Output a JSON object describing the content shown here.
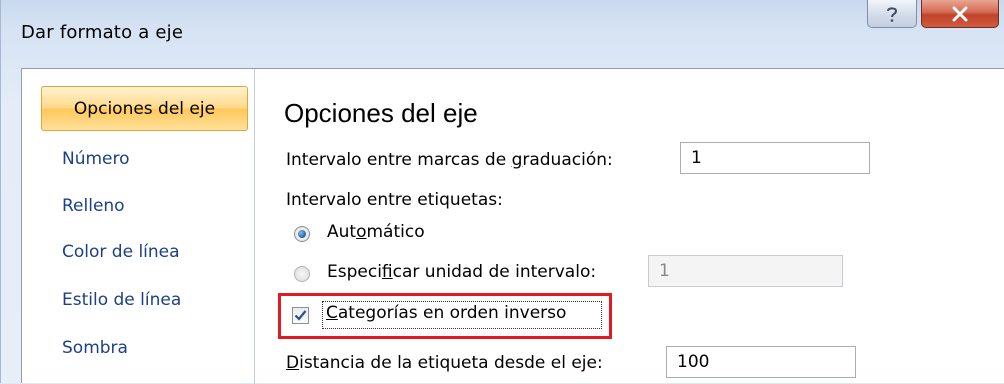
{
  "window": {
    "title": "Dar formato a eje",
    "help_icon": "question-icon",
    "close_icon": "close-x-icon"
  },
  "sidebar": {
    "items": [
      {
        "label": "Opciones del eje",
        "selected": true
      },
      {
        "label": "Número"
      },
      {
        "label": "Relleno"
      },
      {
        "label": "Color de línea"
      },
      {
        "label": "Estilo de línea"
      },
      {
        "label": "Sombra"
      }
    ]
  },
  "main": {
    "section_title": "Opciones del eje",
    "tick_interval": {
      "label_before": "Intervalo entre marcas de ",
      "label_accel": "g",
      "label_after": "raduación:",
      "value": "1"
    },
    "label_interval": {
      "label": "Intervalo entre etiquetas:",
      "auto": {
        "before": "Aut",
        "accel": "o",
        "after": "mático",
        "checked": true
      },
      "specify": {
        "before": "Especi",
        "accel": "f",
        "after": "icar unidad de intervalo:",
        "checked": false,
        "value": "1"
      }
    },
    "reverse_order": {
      "accel": "C",
      "after": "ategorías en orden inverso",
      "checked": true
    },
    "label_distance": {
      "accel": "D",
      "after": "istancia de la etiqueta desde el eje:",
      "value": "100"
    }
  },
  "colors": {
    "highlight": "#e21b23",
    "selected_nav": "#ffd98a",
    "nav_text": "#1d3f8a"
  }
}
